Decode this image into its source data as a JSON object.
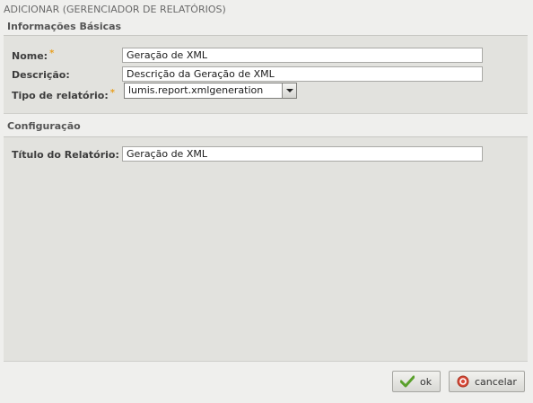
{
  "window": {
    "title": "ADICIONAR (GERENCIADOR DE RELATÓRIOS)"
  },
  "basic_info": {
    "title": "Informações Básicas",
    "name_label": "Nome:",
    "name_value": "Geração de XML",
    "description_label": "Descrição:",
    "description_value": "Descrição da Geração de XML",
    "report_type_label": "Tipo de relatório:",
    "report_type_value": "lumis.report.xmlgeneration",
    "required_mark": "*"
  },
  "configuration": {
    "title": "Configuração",
    "report_title_label": "Título do Relatório:",
    "report_title_value": "Geração de XML"
  },
  "buttons": {
    "ok_label": "ok",
    "cancel_label": "cancelar"
  },
  "colors": {
    "panel_bg": "#e2e2de",
    "required": "#e8a020",
    "ok_check": "#5aa02c",
    "cancel_icon": "#d84a3a"
  }
}
